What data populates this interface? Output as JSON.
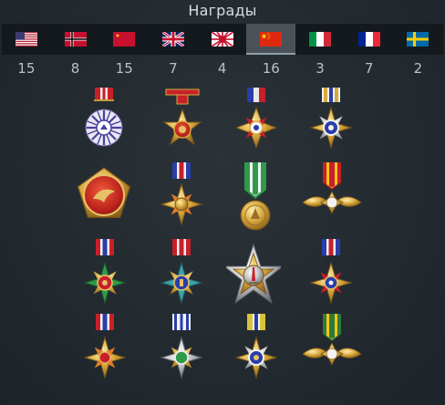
{
  "header": {
    "title": "Награды"
  },
  "nations": [
    {
      "id": "usa",
      "flag": "usa-flag-icon",
      "count": "15"
    },
    {
      "id": "germany",
      "flag": "germany-flag-icon",
      "count": "8"
    },
    {
      "id": "ussr",
      "flag": "ussr-flag-icon",
      "count": "15"
    },
    {
      "id": "britain",
      "flag": "britain-flag-icon",
      "count": "7"
    },
    {
      "id": "japan",
      "flag": "japan-flag-icon",
      "count": "4"
    },
    {
      "id": "china",
      "flag": "china-flag-icon",
      "count": "16",
      "active": true
    },
    {
      "id": "italy",
      "flag": "italy-flag-icon",
      "count": "3"
    },
    {
      "id": "france",
      "flag": "france-flag-icon",
      "count": "7"
    },
    {
      "id": "sweden",
      "flag": "sweden-flag-icon",
      "count": "2"
    }
  ],
  "colors": {
    "background": "#252d33",
    "tab_bar": "#13191d",
    "active_tab": "#4a5257",
    "gold": "#d4a53a"
  }
}
